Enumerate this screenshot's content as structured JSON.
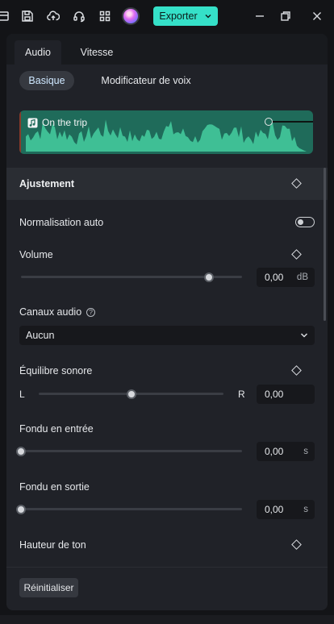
{
  "toolbar": {
    "export_label": "Exporter",
    "accent_color": "#35e0c8"
  },
  "tabs": [
    {
      "label": "Audio",
      "active": true
    },
    {
      "label": "Vitesse",
      "active": false
    }
  ],
  "subtabs": [
    {
      "label": "Basique",
      "active": true
    },
    {
      "label": "Modificateur de voix",
      "active": false
    }
  ],
  "clip": {
    "title": "On the trip",
    "icon": "music-note-icon",
    "wave_color": "#3fbf95"
  },
  "section": {
    "title": "Ajustement"
  },
  "controls": {
    "normalisation": {
      "label": "Normalisation auto",
      "enabled": false
    },
    "volume": {
      "label": "Volume",
      "value": "0,00",
      "unit": "dB",
      "level": 0.85
    },
    "canaux": {
      "label": "Canaux audio",
      "help": "?",
      "selected": "Aucun"
    },
    "equilibre": {
      "label": "Équilibre sonore",
      "left": "L",
      "right": "R",
      "value": "0,00",
      "level": 0.5
    },
    "fondu_entree": {
      "label": "Fondu en entrée",
      "value": "0,00",
      "unit": "s",
      "level": 0.0
    },
    "fondu_sortie": {
      "label": "Fondu en sortie",
      "value": "0,00",
      "unit": "s",
      "level": 0.0
    },
    "hauteur": {
      "label": "Hauteur de ton"
    }
  },
  "footer": {
    "reset_label": "Réinitialiser"
  }
}
